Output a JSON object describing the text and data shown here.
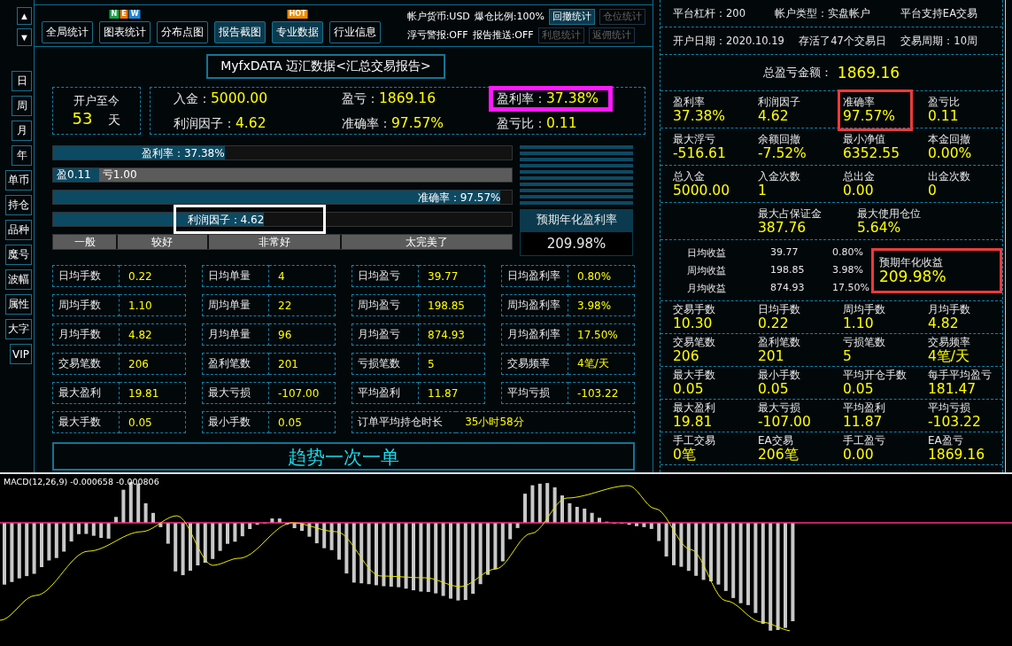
{
  "scroll_arrows": [
    "▲",
    "▼"
  ],
  "side_tabs": [
    {
      "label": "日"
    },
    {
      "label": "周"
    },
    {
      "label": "月"
    },
    {
      "label": "年"
    },
    {
      "label": "单币"
    },
    {
      "label": "持仓"
    },
    {
      "label": "品种"
    },
    {
      "label": "魔号"
    },
    {
      "label": "波幅"
    },
    {
      "label": "属性"
    },
    {
      "label": "大字"
    },
    {
      "label": "VIP"
    }
  ],
  "toolbar": [
    {
      "label": "全局统计",
      "highlighted": false
    },
    {
      "label": "图表统计",
      "highlighted": false,
      "badge": [
        {
          "text": "N",
          "color": "#1aa34a"
        },
        {
          "text": "E",
          "color": "#f07800"
        },
        {
          "text": "W",
          "color": "#1c86d8"
        }
      ]
    },
    {
      "label": "分布点图",
      "highlighted": false
    },
    {
      "label": "报告截图",
      "highlighted": true
    },
    {
      "label": "专业数据",
      "highlighted": true,
      "badge": [
        {
          "text": "HOT",
          "color": "#f08c00"
        }
      ]
    },
    {
      "label": "行业信息",
      "highlighted": false
    }
  ],
  "account_flags": [
    [
      "帐户货币:USD",
      "爆仓比例:100%"
    ],
    [
      "浮亏警报:OFF",
      "报告推送:OFF"
    ]
  ],
  "stat_buttons": [
    [
      {
        "label": "回撤统计",
        "disabled": false
      },
      {
        "label": "仓位统计",
        "disabled": true
      }
    ],
    [
      {
        "label": "利息统计",
        "disabled": true
      },
      {
        "label": "返佣统计",
        "disabled": true
      }
    ]
  ],
  "report_title": "MyfxDATA 迈汇数据<汇总交易报告>",
  "since_open": {
    "label": "开户至今",
    "days": "53",
    "unit": "天"
  },
  "summary": [
    {
      "label": "入金：",
      "value": "5000.00"
    },
    {
      "label": "盈亏：",
      "value": "1869.16"
    },
    {
      "label": "盈利率：",
      "value": "37.38%"
    },
    {
      "label": "利润因子：",
      "value": "4.62"
    },
    {
      "label": "准确率：",
      "value": "97.57%"
    },
    {
      "label": "盈亏比：",
      "value": "0.11"
    }
  ],
  "bars": [
    {
      "kind": "single",
      "label": "盈利率：37.38%",
      "level": 0.3738
    },
    {
      "kind": "split",
      "label": "盈0.11",
      "rest": "亏1.00",
      "level": 0.1
    },
    {
      "kind": "single",
      "label": "准确率：97.57%",
      "level": 0.9757
    },
    {
      "kind": "single",
      "label": "利润因子：4.62",
      "level": 0.46
    }
  ],
  "scale": [
    "一般",
    "较好",
    "非常好",
    "太完美了"
  ],
  "annualized": {
    "label": "预期年化盈利率",
    "value": "209.98%"
  },
  "stats": [
    [
      {
        "label": "日均手数",
        "value": "0.22"
      },
      {
        "label": "日均单量",
        "value": "4"
      },
      {
        "label": "日均盈亏",
        "value": "39.77"
      },
      {
        "label": "日均盈利率",
        "value": "0.80%"
      }
    ],
    [
      {
        "label": "周均手数",
        "value": "1.10"
      },
      {
        "label": "周均单量",
        "value": "22"
      },
      {
        "label": "周均盈亏",
        "value": "198.85"
      },
      {
        "label": "周均盈利率",
        "value": "3.98%"
      }
    ],
    [
      {
        "label": "月均手数",
        "value": "4.82"
      },
      {
        "label": "月均单量",
        "value": "96"
      },
      {
        "label": "月均盈亏",
        "value": "874.93"
      },
      {
        "label": "月均盈利率",
        "value": "17.50%"
      }
    ],
    [
      {
        "label": "交易笔数",
        "value": "206"
      },
      {
        "label": "盈利笔数",
        "value": "201"
      },
      {
        "label": "亏损笔数",
        "value": "5"
      },
      {
        "label": "交易频率",
        "value": "4笔/天"
      }
    ],
    [
      {
        "label": "最大盈利",
        "value": "19.81"
      },
      {
        "label": "最大亏损",
        "value": "-107.00"
      },
      {
        "label": "平均盈利",
        "value": "11.87"
      },
      {
        "label": "平均亏损",
        "value": "-103.22"
      }
    ],
    [
      {
        "label": "最大手数",
        "value": "0.05"
      },
      {
        "label": "最小手数",
        "value": "0.05"
      },
      {
        "label": "订单平均持仓时长",
        "value": "35小时58分"
      }
    ]
  ],
  "strategy_button": "趋势一次一单",
  "right_info": [
    [
      "平台杠杆：200",
      "帐户类型：实盘帐户",
      "平台支持EA交易"
    ],
    [
      "开户日期：2020.10.19",
      "存活了47个交易日",
      "交易周期：10周"
    ]
  ],
  "total_pl": {
    "label": "总盈亏金额：",
    "value": "1869.16"
  },
  "right_grid_top": [
    [
      {
        "label": "盈利率",
        "value": "37.38%"
      },
      {
        "label": "利润因子",
        "value": "4.62"
      },
      {
        "label": "准确率",
        "value": "97.57%"
      },
      {
        "label": "盈亏比",
        "value": "0.11"
      }
    ],
    [
      {
        "label": "最大浮亏",
        "value": "-516.61"
      },
      {
        "label": "余额回撤",
        "value": "-7.52%"
      },
      {
        "label": "最小净值",
        "value": "6352.55"
      },
      {
        "label": "本金回撤",
        "value": "0.00%"
      }
    ],
    [
      {
        "label": "总入金",
        "value": "5000.00"
      },
      {
        "label": "入金次数",
        "value": "1"
      },
      {
        "label": "总出金",
        "value": "0.00"
      },
      {
        "label": "出金次数",
        "value": "0"
      }
    ],
    [
      {
        "label": "最大占保证金",
        "value": "387.76"
      },
      {
        "label": "最大使用仓位",
        "value": "5.64%"
      }
    ]
  ],
  "income": [
    [
      "日均收益",
      "39.77",
      "0.80%"
    ],
    [
      "周均收益",
      "198.85",
      "3.98%"
    ],
    [
      "月均收益",
      "874.93",
      "17.50%"
    ]
  ],
  "expected_income": {
    "label": "预期年化收益",
    "value": "209.98%"
  },
  "right_grid_bottom": [
    [
      {
        "label": "交易手数",
        "value": "10.30"
      },
      {
        "label": "日均手数",
        "value": "0.22"
      },
      {
        "label": "周均手数",
        "value": "1.10"
      },
      {
        "label": "月均手数",
        "value": "4.82"
      }
    ],
    [
      {
        "label": "交易笔数",
        "value": "206"
      },
      {
        "label": "盈利笔数",
        "value": "201"
      },
      {
        "label": "亏损笔数",
        "value": "5"
      },
      {
        "label": "交易频率",
        "value": "4笔/天"
      }
    ],
    [
      {
        "label": "最大手数",
        "value": "0.05"
      },
      {
        "label": "最小手数",
        "value": "0.05"
      },
      {
        "label": "平均开仓手数",
        "value": "0.05"
      },
      {
        "label": "每手平均盈亏",
        "value": "181.47"
      }
    ],
    [
      {
        "label": "最大盈利",
        "value": "19.81"
      },
      {
        "label": "最大亏损",
        "value": "-107.00"
      },
      {
        "label": "平均盈利",
        "value": "11.87"
      },
      {
        "label": "平均亏损",
        "value": "-103.22"
      }
    ],
    [
      {
        "label": "手工交易",
        "value": "0笔"
      },
      {
        "label": "EA交易",
        "value": "206笔"
      },
      {
        "label": "手工盈亏",
        "value": "0.00"
      },
      {
        "label": "EA盈亏",
        "value": "1869.16"
      }
    ]
  ],
  "macd": {
    "label": "MACD(12,26,9) -0.000658 -0.000806"
  }
}
